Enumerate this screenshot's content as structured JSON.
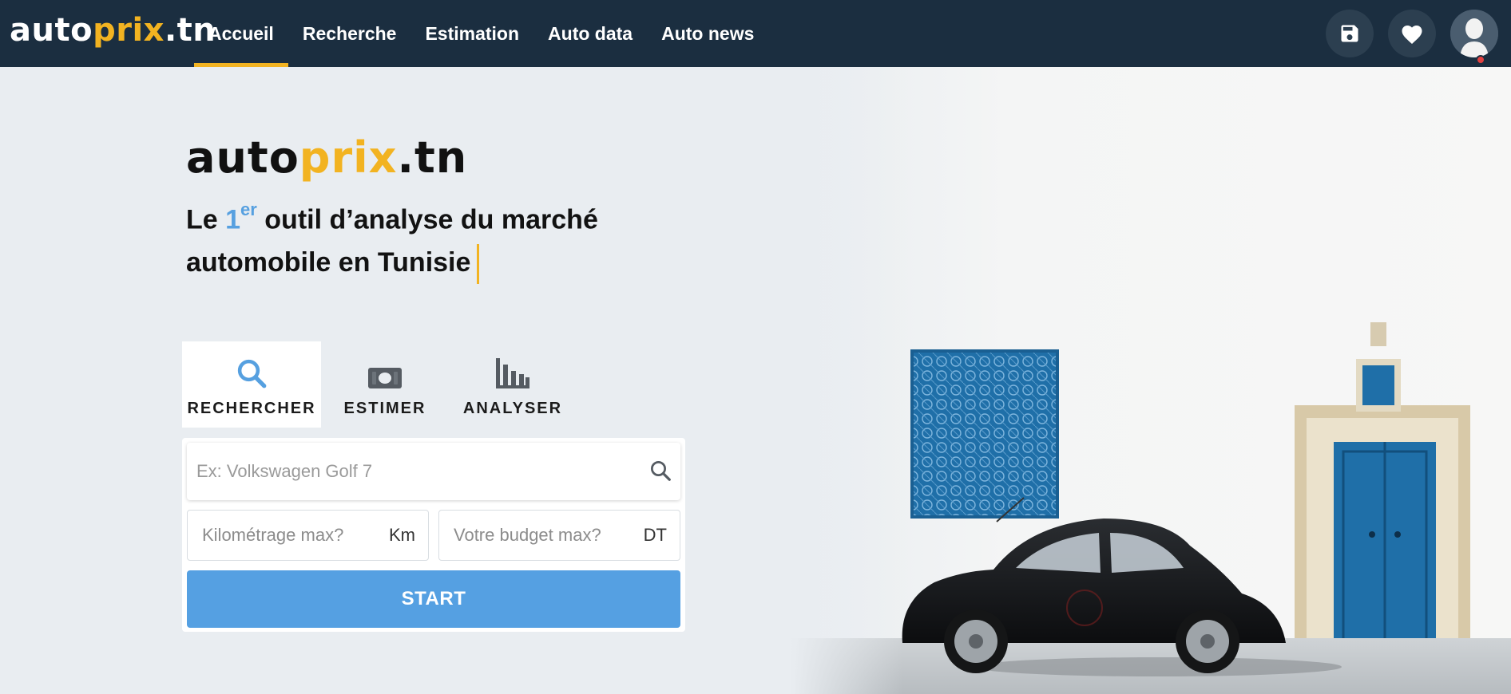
{
  "nav": {
    "logo": {
      "part1": "auto",
      "part2": "prix",
      "part3": ".tn"
    },
    "links": [
      {
        "label": "Accueil",
        "active": true
      },
      {
        "label": "Recherche"
      },
      {
        "label": "Estimation"
      },
      {
        "label": "Auto data"
      },
      {
        "label": "Auto news"
      }
    ],
    "icons": [
      "save-icon",
      "heart-icon",
      "avatar"
    ]
  },
  "hero": {
    "logo": {
      "part1": "auto",
      "part2": "prix",
      "part3": ".tn"
    },
    "title": {
      "before": "Le ",
      "num": "1",
      "sup": "er",
      "after": " outil d’analyse du marché automobile en Tunisie"
    }
  },
  "tabs": [
    {
      "label": "RECHERCHER",
      "icon": "search-icon",
      "active": true
    },
    {
      "label": "ESTIMER",
      "icon": "money-icon"
    },
    {
      "label": "ANALYSER",
      "icon": "bar-chart-icon"
    }
  ],
  "form": {
    "search_placeholder": "Ex: Volkswagen Golf 7",
    "km_placeholder": "Kilométrage max?",
    "km_unit": "Km",
    "budget_placeholder": "Votre budget max?",
    "budget_unit": "DT",
    "start_label": "START"
  },
  "colors": {
    "nav_bg": "#1b2e40",
    "accent_yellow": "#f2b321",
    "accent_blue": "#55a0e2",
    "page_bg": "#e9edf1"
  }
}
